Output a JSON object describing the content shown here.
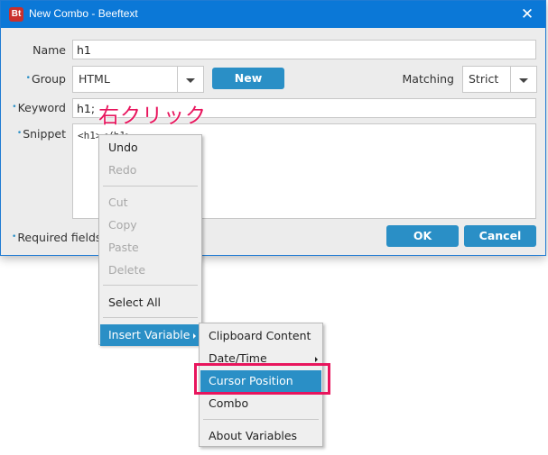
{
  "window": {
    "title": "New Combo - Beeftext",
    "app_icon_text": "Bt",
    "close_glyph": "✕"
  },
  "form": {
    "name": {
      "label": "Name",
      "value": "h1",
      "required": false
    },
    "group": {
      "label": "Group",
      "value": "HTML",
      "required": true
    },
    "new_button": "New",
    "matching": {
      "label": "Matching",
      "value": "Strict"
    },
    "keyword": {
      "label": "Keyword",
      "value": "h1;",
      "required": true
    },
    "snippet": {
      "label": "Snippet",
      "value": "<h1></h1>",
      "required": true
    },
    "required_note": "Required fields",
    "required_marker": "•",
    "ok_button": "OK",
    "cancel_button": "Cancel"
  },
  "annotation": {
    "text": "右クリック",
    "color": "#e8155d"
  },
  "context_menu": {
    "items": [
      {
        "label": "Undo",
        "enabled": true
      },
      {
        "label": "Redo",
        "enabled": false
      },
      {
        "label": "Cut",
        "enabled": false
      },
      {
        "label": "Copy",
        "enabled": false
      },
      {
        "label": "Paste",
        "enabled": false
      },
      {
        "label": "Delete",
        "enabled": false
      },
      {
        "label": "Select All",
        "enabled": true
      },
      {
        "label": "Insert Variable",
        "enabled": true,
        "selected": true,
        "has_submenu": true
      }
    ]
  },
  "submenu": {
    "items": [
      {
        "label": "Clipboard Content"
      },
      {
        "label": "Date/Time",
        "has_submenu": true
      },
      {
        "label": "Cursor Position",
        "selected": true,
        "highlighted": true
      },
      {
        "label": "Combo"
      },
      {
        "label": "About Variables"
      }
    ]
  },
  "colors": {
    "titlebar": "#0b78d7",
    "accent": "#2a8fc6",
    "highlight": "#e8155d"
  }
}
